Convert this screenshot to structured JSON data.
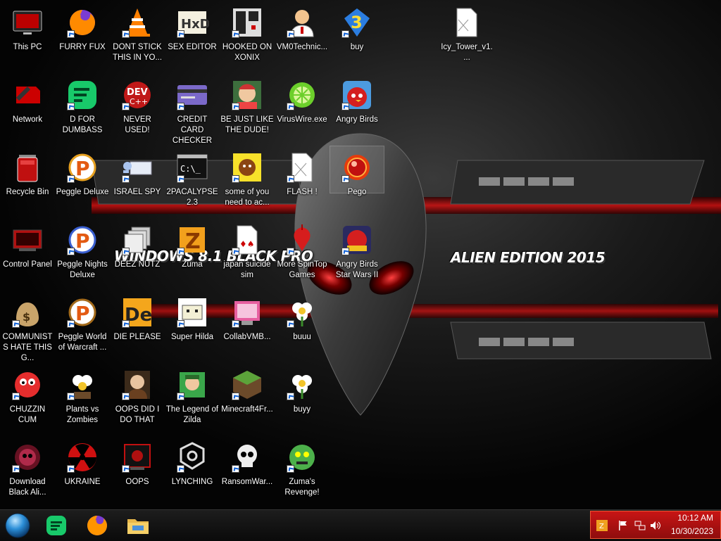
{
  "wallpaper": {
    "text_left": "WINDOWS 8.1 BLACK PRO",
    "text_right": "ALIEN EDITION 2015",
    "accent": "#c01818"
  },
  "desktop_icons": [
    {
      "label": "This PC",
      "icon": "pc-icon"
    },
    {
      "label": "FURRY FUX",
      "icon": "firefox-icon"
    },
    {
      "label": "DONT STICK THIS IN YO...",
      "icon": "vlc-cone-icon"
    },
    {
      "label": "SEX EDITOR",
      "icon": "hxd-icon"
    },
    {
      "label": "HOOKED ON XONIX",
      "icon": "xonix-icon"
    },
    {
      "label": "VM0Technic...",
      "icon": "doctor-icon"
    },
    {
      "label": "buy",
      "icon": "bejeweled-3-icon"
    },
    {
      "label": "Icy_Tower_v1....",
      "icon": "file-icon"
    },
    {
      "label": "Network",
      "icon": "network-icon"
    },
    {
      "label": "D FOR DUMBASS",
      "icon": "chat-icon"
    },
    {
      "label": "NEVER USED!",
      "icon": "devcpp-icon"
    },
    {
      "label": "CREDIT CARD CHECKER",
      "icon": "credit-card-icon"
    },
    {
      "label": "BE JUST LIKE THE DUDE!",
      "icon": "dude-icon"
    },
    {
      "label": "VirusWire.exe",
      "icon": "limewire-icon"
    },
    {
      "label": "Angry Birds",
      "icon": "angry-birds-icon"
    },
    {
      "label": "Recycle Bin",
      "icon": "recycle-bin-icon"
    },
    {
      "label": "Peggle Deluxe",
      "icon": "peggle-icon"
    },
    {
      "label": "ISRAEL SPY",
      "icon": "spy-icon"
    },
    {
      "label": "2PACALYPSE 2.3",
      "icon": "terminal-icon"
    },
    {
      "label": "some of you need to ac...",
      "icon": "dog-icon"
    },
    {
      "label": "FLASH !",
      "icon": "flash-icon"
    },
    {
      "label": "Pego",
      "icon": "pego-icon"
    },
    {
      "label": "Control Panel",
      "icon": "control-panel-icon"
    },
    {
      "label": "Peggle Nights Deluxe",
      "icon": "peggle-nights-icon"
    },
    {
      "label": "DEEZ NUTZ",
      "icon": "stack-icon"
    },
    {
      "label": "Zuma",
      "icon": "zuma-icon"
    },
    {
      "label": "japan suicide sim",
      "icon": "cards-icon"
    },
    {
      "label": "More SpinTop Games",
      "icon": "spintop-icon"
    },
    {
      "label": "Angry Birds Star Wars II",
      "icon": "angry-birds-sw-icon"
    },
    {
      "label": "COMMUNISTS HATE THIS G...",
      "icon": "money-bag-icon"
    },
    {
      "label": "Peggle World of Warcraft ...",
      "icon": "peggle-wow-icon"
    },
    {
      "label": "DIE PLEASE",
      "icon": "de-icon"
    },
    {
      "label": "Super Hilda",
      "icon": "pixel-dog-icon"
    },
    {
      "label": "CollabVMB...",
      "icon": "collab-icon"
    },
    {
      "label": "buuu",
      "icon": "flower-icon"
    },
    {
      "label": "CHUZZIN CUM",
      "icon": "chuzzle-icon"
    },
    {
      "label": "Plants vs Zombies",
      "icon": "pvz-icon"
    },
    {
      "label": "OOPS DID I DO THAT",
      "icon": "portrait-icon"
    },
    {
      "label": "The Legend of Zilda",
      "icon": "zilda-icon"
    },
    {
      "label": "Minecraft4Fr...",
      "icon": "minecraft-icon"
    },
    {
      "label": "buyy",
      "icon": "flower-icon"
    },
    {
      "label": "Download Black Ali...",
      "icon": "alien-icon"
    },
    {
      "label": "UKRAINE",
      "icon": "radiation-icon"
    },
    {
      "label": "OOPS",
      "icon": "oops-icon"
    },
    {
      "label": "LYNCHING",
      "icon": "lynch-icon"
    },
    {
      "label": "RansomWar...",
      "icon": "skull-icon"
    },
    {
      "label": "Zuma's Revenge!",
      "icon": "zuma-revenge-icon"
    }
  ],
  "taskbar": {
    "pinned": [
      {
        "name": "start-orb-icon"
      },
      {
        "name": "chat-app-icon"
      },
      {
        "name": "firefox-icon"
      },
      {
        "name": "file-explorer-icon"
      }
    ],
    "tray_icons": [
      "app-tray-icon",
      "flag-icon",
      "network-tray-icon",
      "volume-icon"
    ]
  },
  "clock": {
    "time": "10:12 AM",
    "date": "10/30/2023"
  }
}
